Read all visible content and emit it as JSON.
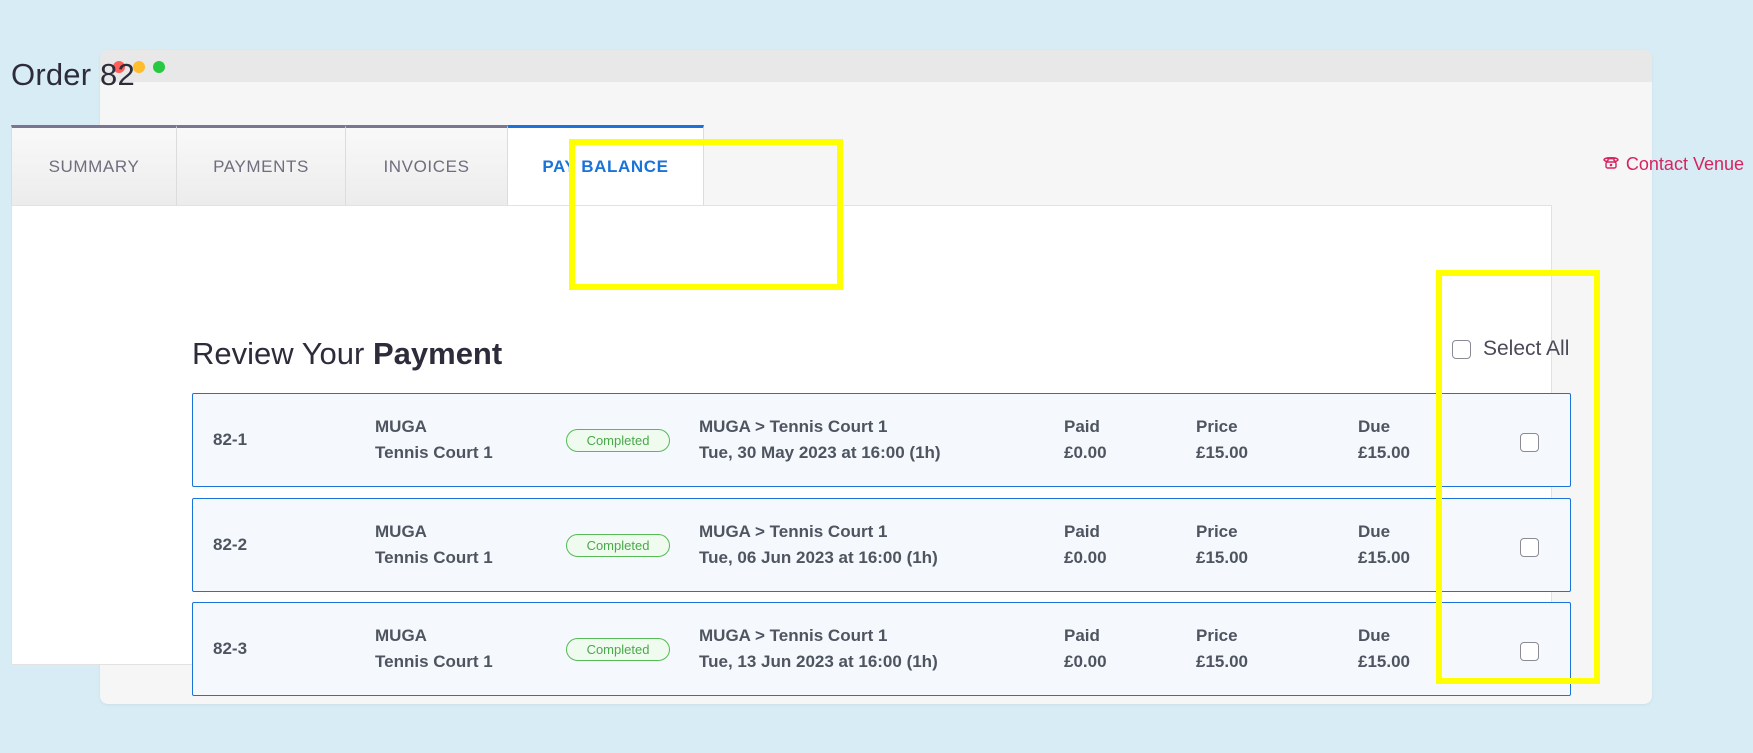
{
  "window": {
    "title": ""
  },
  "page": {
    "title": "Order 82"
  },
  "tabs": [
    {
      "label": "SUMMARY",
      "active": false
    },
    {
      "label": "PAYMENTS",
      "active": false
    },
    {
      "label": "INVOICES",
      "active": false
    },
    {
      "label": "PAY BALANCE",
      "active": true
    }
  ],
  "contact": {
    "label": "Contact Venue",
    "icon": "phone-icon"
  },
  "review": {
    "prefix": "Review Your",
    "bold": "Payment"
  },
  "select_all": {
    "label": "Select All",
    "checked": false
  },
  "rows": [
    {
      "ref": "82-1",
      "venue": "MUGA",
      "court": "Tennis Court 1",
      "status": "Completed",
      "path": "MUGA > Tennis Court 1",
      "when": "Tue, 30 May 2023 at 16:00 (1h)",
      "paid_label": "Paid",
      "paid": "£0.00",
      "price_label": "Price",
      "price": "£15.00",
      "due_label": "Due",
      "due": "£15.00",
      "checked": false
    },
    {
      "ref": "82-2",
      "venue": "MUGA",
      "court": "Tennis Court 1",
      "status": "Completed",
      "path": "MUGA > Tennis Court 1",
      "when": "Tue, 06 Jun 2023 at 16:00 (1h)",
      "paid_label": "Paid",
      "paid": "£0.00",
      "price_label": "Price",
      "price": "£15.00",
      "due_label": "Due",
      "due": "£15.00",
      "checked": false
    },
    {
      "ref": "82-3",
      "venue": "MUGA",
      "court": "Tennis Court 1",
      "status": "Completed",
      "path": "MUGA > Tennis Court 1",
      "when": "Tue, 13 Jun 2023 at 16:00 (1h)",
      "paid_label": "Paid",
      "paid": "£0.00",
      "price_label": "Price",
      "price": "£15.00",
      "due_label": "Due",
      "due": "£15.00",
      "checked": false
    }
  ],
  "colors": {
    "accent": "#1a73d9",
    "contact": "#d6245e",
    "status": "#4ba84b",
    "highlight": "#ffff00"
  }
}
